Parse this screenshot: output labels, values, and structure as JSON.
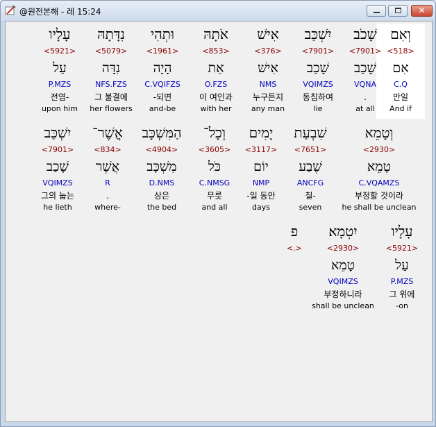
{
  "window": {
    "title": "@원전본해 - 레 15:24",
    "colors": {
      "strong": "#8b0000",
      "morph": "#0000c0"
    }
  },
  "controls": {
    "minimize_icon": "minimize-icon",
    "maximize_icon": "maximize-icon",
    "close_icon": "close-icon",
    "close_glyph": "✕"
  },
  "words": [
    {
      "heb": "וְאִם",
      "strong": "<518>",
      "lemma": "אִם",
      "morph": "C.Q",
      "kor": "만일",
      "eng": "And if"
    },
    {
      "heb": "שָׁכֹב",
      "strong": "<7901>",
      "lemma": "שָׁכַב",
      "morph": "VQNA",
      "kor": ".",
      "eng": "at all"
    },
    {
      "heb": "יִשְׁכַּב",
      "strong": "<7901>",
      "lemma": "שָׁכַב",
      "morph": "VQIMZS",
      "kor": "동침하여",
      "eng": "lie"
    },
    {
      "heb": "אִישׁ",
      "strong": "<376>",
      "lemma": "אִישׁ",
      "morph": "NMS",
      "kor": "누구든지",
      "eng": "any man"
    },
    {
      "heb": "אֹתָהּ",
      "strong": "<853>",
      "lemma": "אֵת",
      "morph": "O.FZS",
      "kor": "이 여인과",
      "eng": "with her"
    },
    {
      "heb": "וּתְהִי",
      "strong": "<1961>",
      "lemma": "הָיָה",
      "morph": "C.VQIFZS",
      "kor": "-되면",
      "eng": "and-be"
    },
    {
      "heb": "נִדָּתָהּ",
      "strong": "<5079>",
      "lemma": "נִדָּה",
      "morph": "NFS.FZS",
      "kor": "그 불결에",
      "eng": "her flowers"
    },
    {
      "heb": "עָלָיו",
      "strong": "<5921>",
      "lemma": "עַל",
      "morph": "P.MZS",
      "kor": "전염-",
      "eng": "upon him"
    },
    {
      "heb": "וְטָמֵא",
      "strong": "<2930>",
      "lemma": "טָמֵא",
      "morph": "C.VQAMZS",
      "kor": "부정할 것이라",
      "eng": "he shall be unclean"
    },
    {
      "heb": "שִׁבְעַת",
      "strong": "<7651>",
      "lemma": "שֶׁבַע",
      "morph": "ANCFG",
      "kor": "칠-",
      "eng": "seven"
    },
    {
      "heb": "יָמִים",
      "strong": "<3117>",
      "lemma": "יוֹם",
      "morph": "NMP",
      "kor": "-일 동안",
      "eng": "days"
    },
    {
      "heb": "וְכָל־",
      "strong": "<3605>",
      "lemma": "כֹּל",
      "morph": "C.NMSG",
      "kor": "무릇",
      "eng": "and all"
    },
    {
      "heb": "הַמִּשְׁכָּב",
      "strong": "<4904>",
      "lemma": "מִשְׁכָּב",
      "morph": "D.NMS",
      "kor": "상은",
      "eng": "the bed"
    },
    {
      "heb": "אֲשֶׁר־",
      "strong": "<834>",
      "lemma": "אֲשֶׁר",
      "morph": "R",
      "kor": ".",
      "eng": "where-"
    },
    {
      "heb": "יִשְׁכַּב",
      "strong": "<7901>",
      "lemma": "שָׁכַב",
      "morph": "VQIMZS",
      "kor": "그의 눕는",
      "eng": "he lieth"
    },
    {
      "heb": "עָלָיו",
      "strong": "<5921>",
      "lemma": "עַל",
      "morph": "P.MZS",
      "kor": "그 위에",
      "eng": "-on"
    },
    {
      "heb": "יִטְמָא׃",
      "strong": "<2930>",
      "lemma": "טָמֵא",
      "morph": "VQIMZS",
      "kor": "부정하니라",
      "eng": "shall be unclean"
    },
    {
      "heb": "פ",
      "strong": "<.>",
      "lemma": "",
      "morph": "",
      "kor": "",
      "eng": ""
    }
  ]
}
